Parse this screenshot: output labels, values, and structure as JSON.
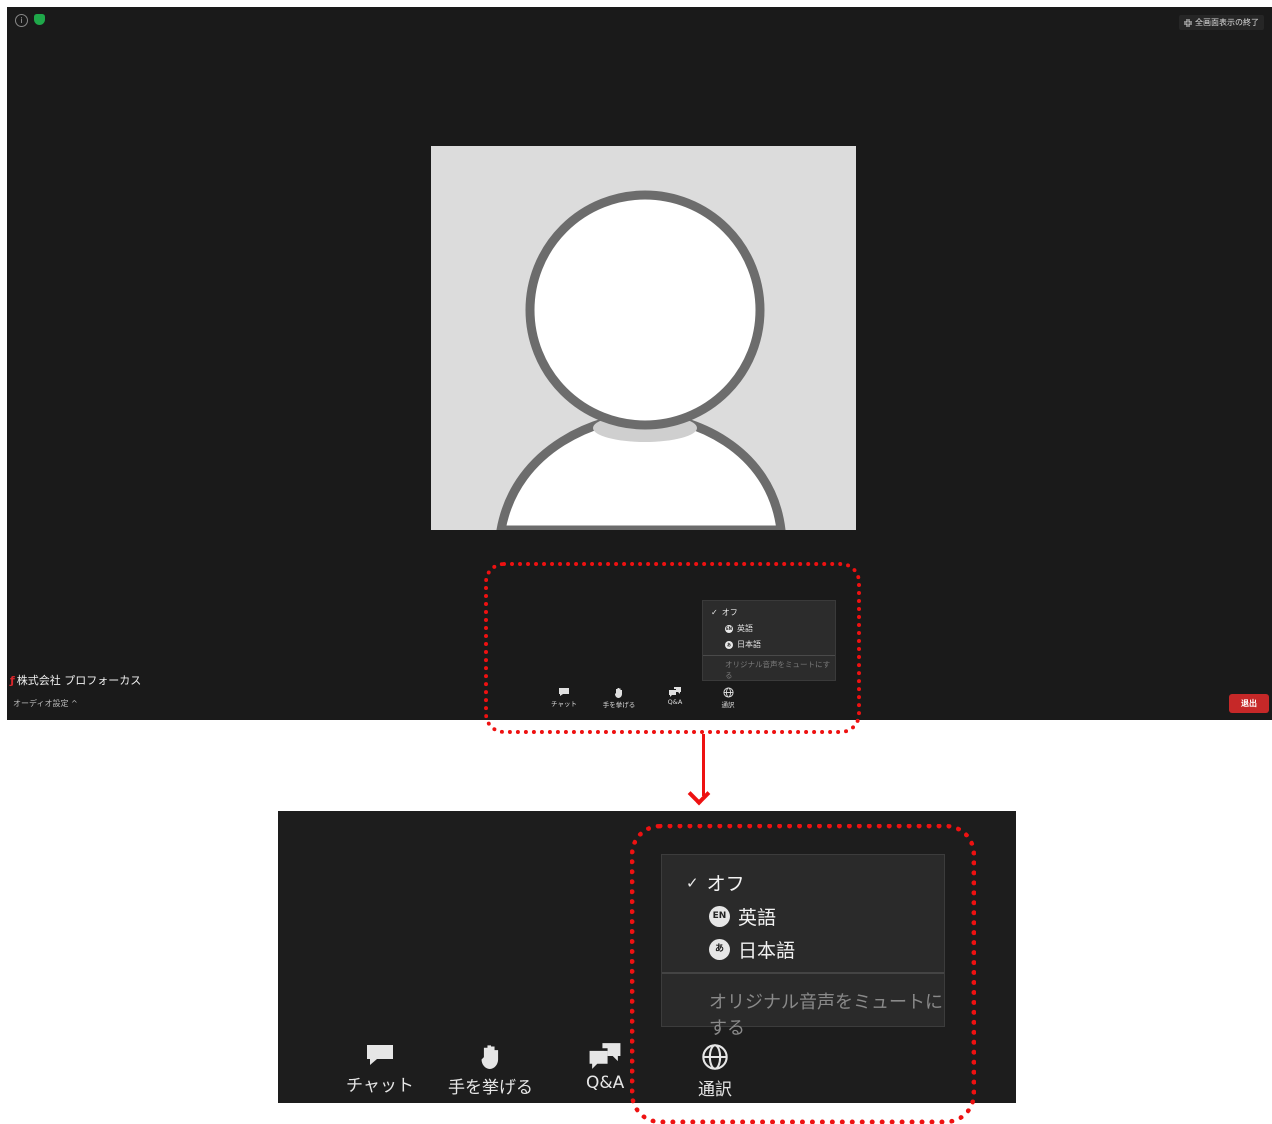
{
  "meeting": {
    "exit_fullscreen_label": "全画面表示の終了",
    "company_name": "株式会社 プロフォーカス",
    "audio_settings_label": "オーディオ設定",
    "leave_label": "退出"
  },
  "interpretation_menu": {
    "off_label": "オフ",
    "english_label": "英語",
    "english_badge": "EN",
    "japanese_label": "日本語",
    "japanese_badge": "あ",
    "mute_original_label": "オリジナル音声をミュートにする"
  },
  "toolbar": {
    "chat_label": "チャット",
    "raise_hand_label": "手を挙げる",
    "qa_label": "Q&A",
    "interpretation_label": "通訳"
  },
  "colors": {
    "background": "#1a1a1a",
    "popup": "#2a2a2a",
    "leave_button": "#c62828",
    "highlight_dots": "#ee1111"
  }
}
